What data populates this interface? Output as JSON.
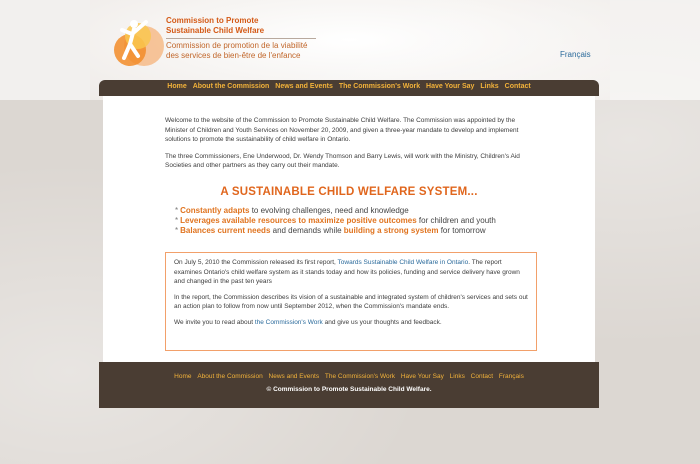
{
  "header": {
    "logo_en_line1": "Commission to Promote",
    "logo_en_line2": "Sustainable Child Welfare",
    "logo_fr_line1": "Commission de promotion de la viabilité",
    "logo_fr_line2": "des services de bien-être de l'enfance",
    "language_link": "Français"
  },
  "nav": {
    "items": [
      "Home",
      "About the Commission",
      "News and Events",
      "The Commission's Work",
      "Have Your Say",
      "Links",
      "Contact"
    ]
  },
  "main": {
    "intro_p1": "Welcome to the website of the Commission to Promote Sustainable Child Welfare. The Commission was appointed by the Minister of Children and Youth Services on November 20, 2009, and given a three-year mandate to develop and implement solutions to promote the sustainability of child welfare in Ontario.",
    "intro_p2": "The three Commissioners, Ene Underwood, Dr. Wendy Thomson and Barry Lewis, will work with the Ministry, Children's Aid Societies and other partners as they carry out their mandate.",
    "slogan": "A SUSTAINABLE CHILD WELFARE SYSTEM...",
    "bullets": [
      {
        "hi1": "Constantly adapts",
        "text1": " to evolving challenges, need and knowledge",
        "hi2": "",
        "text2": ""
      },
      {
        "hi1": "Leverages available resources to maximize positive outcomes",
        "text1": " for children and youth",
        "hi2": "",
        "text2": ""
      },
      {
        "hi1": "Balances current needs",
        "text1": " and demands while ",
        "hi2": "building a strong system",
        "text2": " for tomorrow"
      }
    ],
    "notice": {
      "p1_before": "On July 5, 2010 the Commission released its first report, ",
      "p1_link": "Towards Sustainable Child Welfare in Ontario",
      "p1_after": ". The report examines Ontario's child welfare system as it stands today and how its policies, funding and service delivery have grown and changed in the past ten years",
      "p2": "In the report, the Commission describes its vision of a sustainable and integrated system of children's services and sets out an action plan to follow from now until September 2012, when the Commission's mandate ends.",
      "p3_before": "We invite you to read about ",
      "p3_link": "the Commission's Work",
      "p3_after": " and give us your thoughts and feedback."
    }
  },
  "footer": {
    "items": [
      "Home",
      "About the Commission",
      "News and Events",
      "The Commission's Work",
      "Have Your Say",
      "Links",
      "Contact",
      "Français"
    ],
    "copyright": "© Commission to Promote Sustainable Child Welfare."
  },
  "colors": {
    "accent_orange": "#e0661d",
    "nav_gold": "#f2b23a",
    "frame_brown": "#4a3d33",
    "link_blue": "#2a6a9b"
  }
}
